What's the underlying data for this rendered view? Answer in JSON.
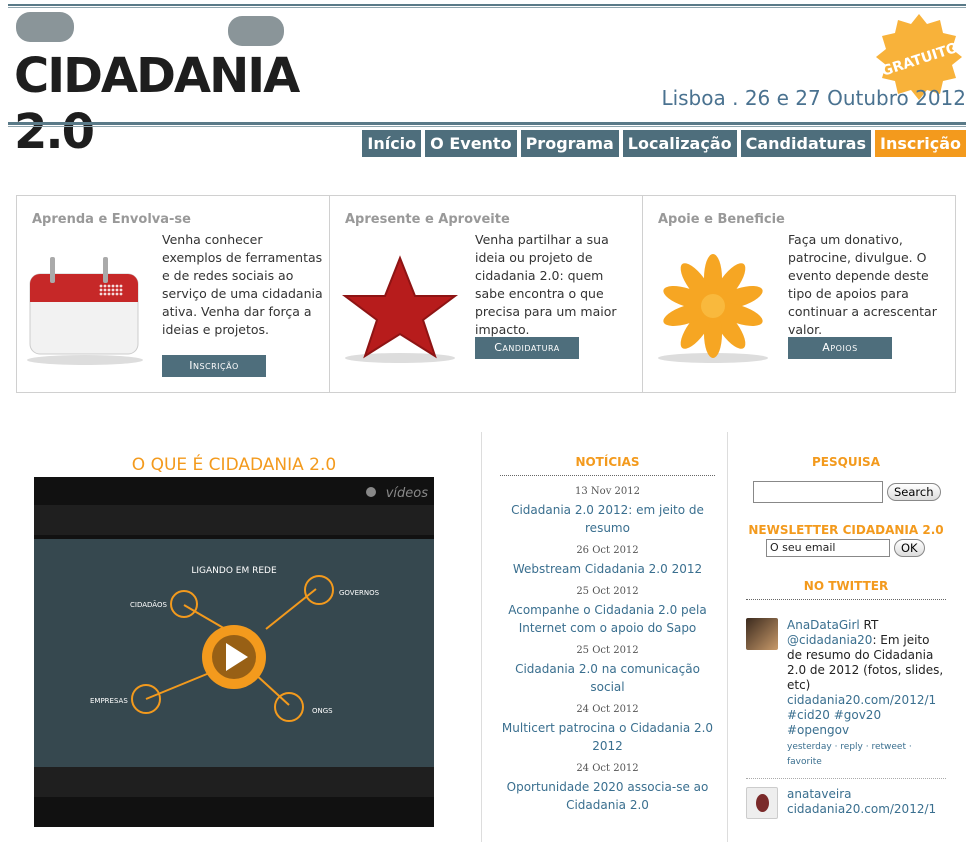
{
  "header": {
    "logo_text": "CIDADANIA 2.0",
    "badge": "GRATUITO",
    "date_line": "Lisboa . 26 e 27 Outubro 2012"
  },
  "nav": [
    "Início",
    "O Evento",
    "Programa",
    "Localização",
    "Candidaturas",
    "Inscrição"
  ],
  "features": [
    {
      "title": "Aprenda e Envolva-se",
      "text": "Venha conhecer exemplos de ferramentas e de redes sociais ao serviço de uma cidadania ativa. Venha dar força a ideias e projetos.",
      "button": "Inscrição",
      "icon": "calendar-icon"
    },
    {
      "title": "Apresente e Aproveite",
      "text": "Venha partilhar a sua ideia ou projeto de cidadania 2.0: quem sabe encontra o que precisa para um maior impacto.",
      "button": "Candidatura",
      "icon": "star-icon"
    },
    {
      "title": "Apoie e Beneficie",
      "text": "Faça um donativo, patrocine, divulgue. O evento depende deste tipo de apoios para continuar a acrescentar valor.",
      "button": "Apoios",
      "icon": "flower-icon"
    }
  ],
  "main": {
    "heading": "O QUE É CIDADANIA 2.0",
    "video": {
      "watermark": "vídeos",
      "title": "LIGANDO EM REDE",
      "labels": {
        "cidadaos": "CIDADÃOS",
        "governos": "GOVERNOS",
        "empresas": "EMPRESAS",
        "ongs": "ONGS"
      }
    }
  },
  "news": {
    "title": "NOTÍCIAS",
    "items": [
      {
        "date": "13 Nov 2012",
        "title": "Cidadania 2.0 2012: em jeito de resumo"
      },
      {
        "date": "26 Oct 2012",
        "title": "Webstream Cidadania 2.0 2012"
      },
      {
        "date": "25 Oct 2012",
        "title": "Acompanhe o Cidadania 2.0 pela Internet com o apoio do Sapo"
      },
      {
        "date": "25 Oct 2012",
        "title": "Cidadania 2.0 na comunicação social"
      },
      {
        "date": "24 Oct 2012",
        "title": "Multicert patrocina o Cidadania 2.0 2012"
      },
      {
        "date": "24 Oct 2012",
        "title": "Oportunidade 2020 associa-se ao Cidadania 2.0"
      }
    ]
  },
  "sidebar": {
    "search_title": "PESQUISA",
    "search_button": "Search",
    "newsletter_title": "NEWSLETTER CIDADANIA 2.0",
    "email_value": "O seu email",
    "ok_button": "OK",
    "twitter_title": "NO TWITTER",
    "tweets": [
      {
        "user": "AnaDataGirl",
        "rt": " RT ",
        "mention": "@cidadania20",
        "text": ": Em jeito de resumo do Cidadania 2.0 de 2012 (fotos, slides, etc) ",
        "link": "cidadania20.com/2012/1",
        "tags": "#cid20 #gov20 #opengov",
        "meta": "yesterday · reply · retweet · favorite"
      },
      {
        "user": "anataveira",
        "link": "cidadania20.com/2012/1"
      }
    ]
  },
  "colors": {
    "accent": "#f39a1d",
    "nav": "#4e6e7c",
    "link": "#3a6f8f"
  }
}
